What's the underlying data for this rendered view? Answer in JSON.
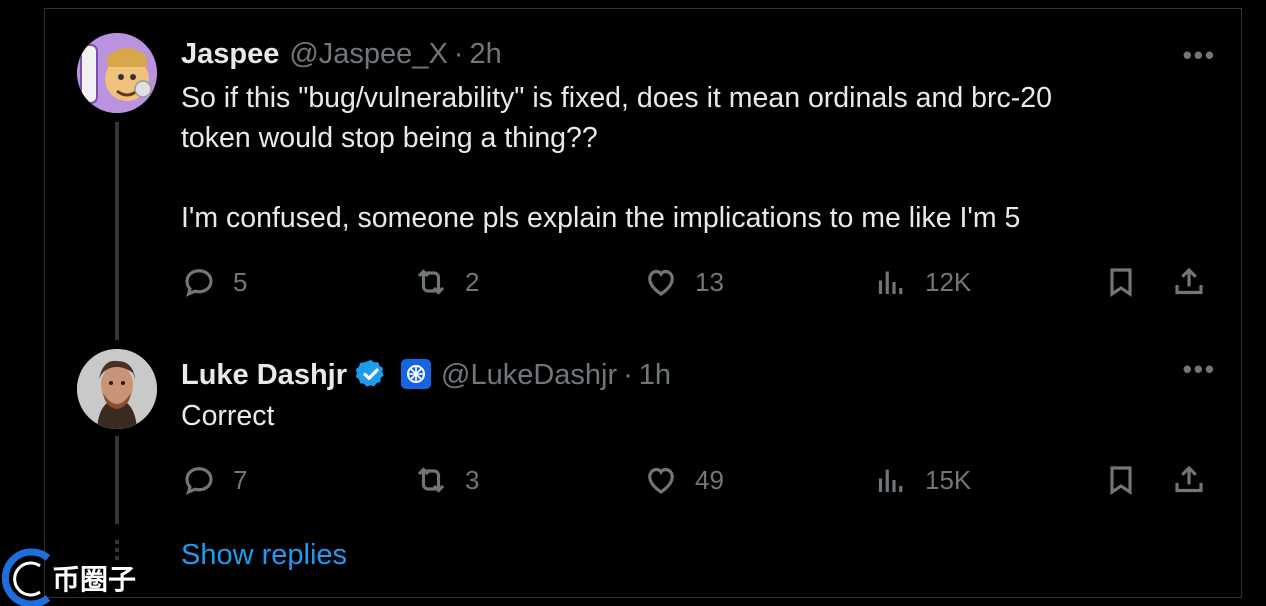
{
  "tweets": [
    {
      "name": "Jaspee",
      "handle": "@Jaspee_X",
      "time": "2h",
      "text": [
        "So if this \"bug/vulnerability\" is fixed, does it mean ordinals and brc-20",
        "token would stop being a thing??",
        "",
        "I'm confused, someone pls explain the implications to me like I'm 5"
      ],
      "replies": "5",
      "retweets": "2",
      "likes": "13",
      "views": "12K"
    },
    {
      "name": "Luke Dashjr",
      "handle": "@LukeDashjr",
      "time": "1h",
      "text": [
        "Correct"
      ],
      "replies": "7",
      "retweets": "3",
      "likes": "49",
      "views": "15K"
    }
  ],
  "separator": "·",
  "more_label": "•••",
  "show_replies": "Show replies",
  "watermark_text": "币圈子",
  "colors": {
    "background": "#000000",
    "text": "#e7e9ea",
    "muted": "#71767b",
    "accent": "#1d9bf0",
    "verified": "#1d9bf0"
  },
  "icons": [
    "reply-icon",
    "retweet-icon",
    "like-icon",
    "views-icon",
    "bookmark-icon",
    "share-icon",
    "more-icon",
    "verified-badge-icon",
    "org-badge-icon"
  ]
}
